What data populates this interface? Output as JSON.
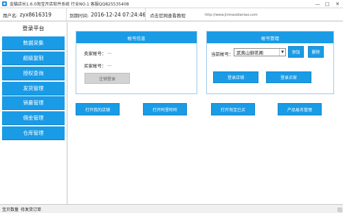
{
  "window": {
    "title": "金猫店长1.6.0淘宝开店软件系统  行业NO.1  客服QQ825535408",
    "minimize": "—",
    "maximize": "□",
    "close": "✕"
  },
  "infobar": {
    "user_label": "用户名:",
    "user_value": "zyx8616319",
    "expire_label": "到期时间:",
    "expire_value": "2016-12-24 07:24:46",
    "website_hint": "点击官网查看教程",
    "website_url": "http://www.jinmaodiantao.com"
  },
  "sidebar": {
    "title": "登录平台",
    "items": [
      {
        "label": "数据采集"
      },
      {
        "label": "超级复制"
      },
      {
        "label": "授权查询"
      },
      {
        "label": "发货管理"
      },
      {
        "label": "销量管理"
      },
      {
        "label": "佣金管理"
      },
      {
        "label": "仓库管理"
      }
    ]
  },
  "account_info": {
    "title": "帐号信息",
    "seller_label": "卖家帐号：",
    "seller_value": "...",
    "buyer_label": "买家帐号：",
    "buyer_value": "...",
    "logout_button": "注销登录"
  },
  "account_manage": {
    "title": "帐号管理",
    "current_label": "当前帐号：",
    "current_value": "武夷山御茗阁",
    "add_button": "添加",
    "delete_button": "删除",
    "login_shop_button": "登录店铺",
    "login_buyer_button": "登录买家"
  },
  "actions": {
    "open_my_shop": "打开我的店铺",
    "open_aliwangwang": "打开阿里旺旺",
    "open_taobao_sites": "打开淘宝已买",
    "product_title_mgmt": "产品易名管理"
  },
  "statusbar": {
    "items": [
      "宝贝数量",
      "待发货订单"
    ]
  }
}
